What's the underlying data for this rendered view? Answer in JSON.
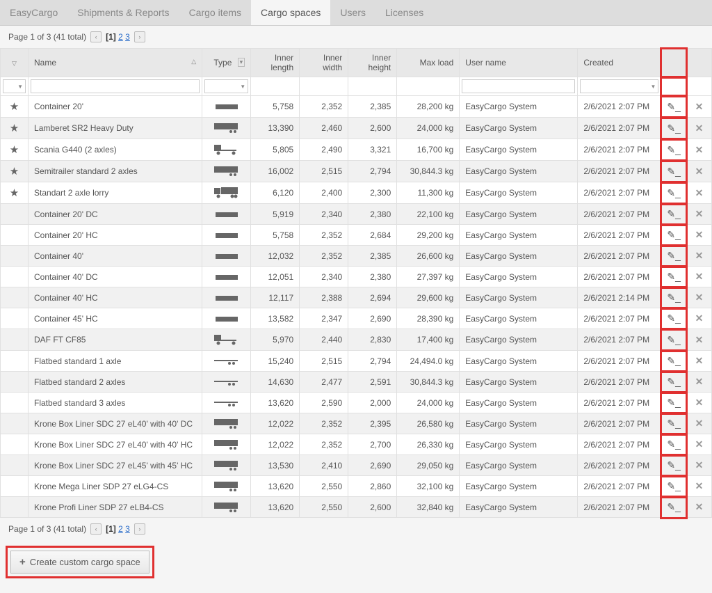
{
  "tabs": [
    "EasyCargo",
    "Shipments & Reports",
    "Cargo items",
    "Cargo spaces",
    "Users",
    "Licenses"
  ],
  "activeTab": 3,
  "pagination": {
    "text": "Page 1 of 3 (41 total)",
    "pages": [
      "1",
      "2",
      "3"
    ],
    "current": 0
  },
  "headers": {
    "name": "Name",
    "type": "Type",
    "innerLength": "Inner length",
    "innerWidth": "Inner width",
    "innerHeight": "Inner height",
    "maxLoad": "Max load",
    "userName": "User name",
    "created": "Created"
  },
  "rows": [
    {
      "star": true,
      "name": "Container 20'",
      "type": "container",
      "len": "5,758",
      "wid": "2,352",
      "hei": "2,385",
      "load": "28,200 kg",
      "user": "EasyCargo System",
      "created": "2/6/2021 2:07 PM"
    },
    {
      "star": true,
      "name": "Lamberet SR2 Heavy Duty",
      "type": "trailer",
      "len": "13,390",
      "wid": "2,460",
      "hei": "2,600",
      "load": "24,000 kg",
      "user": "EasyCargo System",
      "created": "2/6/2021 2:07 PM"
    },
    {
      "star": true,
      "name": "Scania G440 (2 axles)",
      "type": "cab",
      "len": "5,805",
      "wid": "2,490",
      "hei": "3,321",
      "load": "16,700 kg",
      "user": "EasyCargo System",
      "created": "2/6/2021 2:07 PM"
    },
    {
      "star": true,
      "name": "Semitrailer standard 2 axles",
      "type": "trailer",
      "len": "16,002",
      "wid": "2,515",
      "hei": "2,794",
      "load": "30,844.3 kg",
      "user": "EasyCargo System",
      "created": "2/6/2021 2:07 PM"
    },
    {
      "star": true,
      "name": "Standart 2 axle lorry",
      "type": "truck",
      "len": "6,120",
      "wid": "2,400",
      "hei": "2,300",
      "load": "11,300 kg",
      "user": "EasyCargo System",
      "created": "2/6/2021 2:07 PM"
    },
    {
      "star": false,
      "name": "Container 20' DC",
      "type": "container",
      "len": "5,919",
      "wid": "2,340",
      "hei": "2,380",
      "load": "22,100 kg",
      "user": "EasyCargo System",
      "created": "2/6/2021 2:07 PM"
    },
    {
      "star": false,
      "name": "Container 20' HC",
      "type": "container",
      "len": "5,758",
      "wid": "2,352",
      "hei": "2,684",
      "load": "29,200 kg",
      "user": "EasyCargo System",
      "created": "2/6/2021 2:07 PM"
    },
    {
      "star": false,
      "name": "Container 40'",
      "type": "container",
      "len": "12,032",
      "wid": "2,352",
      "hei": "2,385",
      "load": "26,600 kg",
      "user": "EasyCargo System",
      "created": "2/6/2021 2:07 PM"
    },
    {
      "star": false,
      "name": "Container 40' DC",
      "type": "container",
      "len": "12,051",
      "wid": "2,340",
      "hei": "2,380",
      "load": "27,397 kg",
      "user": "EasyCargo System",
      "created": "2/6/2021 2:07 PM"
    },
    {
      "star": false,
      "name": "Container 40' HC",
      "type": "container",
      "len": "12,117",
      "wid": "2,388",
      "hei": "2,694",
      "load": "29,600 kg",
      "user": "EasyCargo System",
      "created": "2/6/2021 2:14 PM"
    },
    {
      "star": false,
      "name": "Container 45' HC",
      "type": "container",
      "len": "13,582",
      "wid": "2,347",
      "hei": "2,690",
      "load": "28,390 kg",
      "user": "EasyCargo System",
      "created": "2/6/2021 2:07 PM"
    },
    {
      "star": false,
      "name": "DAF FT CF85",
      "type": "cab",
      "len": "5,970",
      "wid": "2,440",
      "hei": "2,830",
      "load": "17,400 kg",
      "user": "EasyCargo System",
      "created": "2/6/2021 2:07 PM"
    },
    {
      "star": false,
      "name": "Flatbed standard 1 axle",
      "type": "flatbed",
      "len": "15,240",
      "wid": "2,515",
      "hei": "2,794",
      "load": "24,494.0 kg",
      "user": "EasyCargo System",
      "created": "2/6/2021 2:07 PM"
    },
    {
      "star": false,
      "name": "Flatbed standard 2 axles",
      "type": "flatbed",
      "len": "14,630",
      "wid": "2,477",
      "hei": "2,591",
      "load": "30,844.3 kg",
      "user": "EasyCargo System",
      "created": "2/6/2021 2:07 PM"
    },
    {
      "star": false,
      "name": "Flatbed standard 3 axles",
      "type": "flatbed",
      "len": "13,620",
      "wid": "2,590",
      "hei": "2,000",
      "load": "24,000 kg",
      "user": "EasyCargo System",
      "created": "2/6/2021 2:07 PM"
    },
    {
      "star": false,
      "name": "Krone Box Liner SDC 27 eL40' with 40' DC",
      "type": "trailer",
      "len": "12,022",
      "wid": "2,352",
      "hei": "2,395",
      "load": "26,580 kg",
      "user": "EasyCargo System",
      "created": "2/6/2021 2:07 PM"
    },
    {
      "star": false,
      "name": "Krone Box Liner SDC 27 eL40' with 40' HC",
      "type": "trailer",
      "len": "12,022",
      "wid": "2,352",
      "hei": "2,700",
      "load": "26,330 kg",
      "user": "EasyCargo System",
      "created": "2/6/2021 2:07 PM"
    },
    {
      "star": false,
      "name": "Krone Box Liner SDC 27 eL45' with 45' HC",
      "type": "trailer",
      "len": "13,530",
      "wid": "2,410",
      "hei": "2,690",
      "load": "29,050 kg",
      "user": "EasyCargo System",
      "created": "2/6/2021 2:07 PM"
    },
    {
      "star": false,
      "name": "Krone Mega Liner SDP 27 eLG4-CS",
      "type": "trailer",
      "len": "13,620",
      "wid": "2,550",
      "hei": "2,860",
      "load": "32,100 kg",
      "user": "EasyCargo System",
      "created": "2/6/2021 2:07 PM"
    },
    {
      "star": false,
      "name": "Krone Profi Liner SDP 27 eLB4-CS",
      "type": "trailer",
      "len": "13,620",
      "wid": "2,550",
      "hei": "2,600",
      "load": "32,840 kg",
      "user": "EasyCargo System",
      "created": "2/6/2021 2:07 PM"
    }
  ],
  "createBtn": "Create custom cargo space"
}
